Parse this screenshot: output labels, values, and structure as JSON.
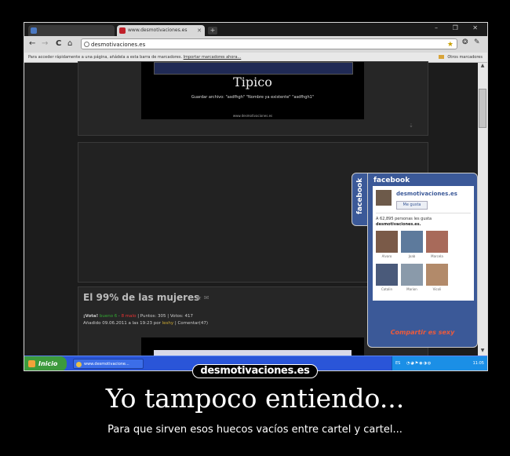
{
  "browser": {
    "tabs": [
      {
        "label": ""
      },
      {
        "label": "www.desmotivaciones.es"
      }
    ],
    "newtab_label": "+",
    "window_controls": "– ❐ ✕",
    "nav": {
      "back": "←",
      "forward": "→",
      "reload": "C",
      "home": "⌂"
    },
    "url": "desmotivaciones.es",
    "bookmarks_bar": {
      "message": "Para acceder rápidamente a una página, añádela a esta barra de marcadores.",
      "import_link": "Importar marcadores ahora...",
      "other_bookmarks": "Otros marcadores"
    }
  },
  "page": {
    "poster1": {
      "title": "Tipico",
      "subtitle": "Guardar archivo: \"asdfhgh\" \"Nombre ya existente\" \"asdfhgh1\"",
      "site": "www.desmotivaciones.es"
    },
    "post": {
      "title": "El 99% de las mujeres",
      "vote_label": "¡Vota!",
      "good": "bueno 6",
      "bad": "8 malo",
      "points": "| Puntos: 305 | Votos: 417",
      "added": "Añadido 09.06.2011 a las 19:23 por",
      "user": "leshy",
      "comments": "| Comentar(47)"
    }
  },
  "facebook_widget": {
    "tab_label": "facebook",
    "header": "facebook",
    "page_name": "desmotivaciones.es",
    "like_button": "Me gusta",
    "count_text": "A 62,895 personas les gusta",
    "count_page": "desmotivaciones.es.",
    "fans": [
      {
        "name": "Alvaro",
        "color": "#7a5a48"
      },
      {
        "name": "Joab",
        "color": "#5d7a9c"
      },
      {
        "name": "Marcela",
        "color": "#a86a5a"
      },
      {
        "name": "Catalin",
        "color": "#4a5a7a"
      },
      {
        "name": "Marion",
        "color": "#8a9aaa"
      },
      {
        "name": "Vicoli",
        "color": "#b28a6a"
      }
    ],
    "footer": "Compartir es sexy"
  },
  "taskbar": {
    "start": "Inicio",
    "task": "www.desmotivacione...",
    "lang": "ES",
    "clock": "11:05"
  },
  "brand": "desmotivaciones.es",
  "headline": "Yo tampoco entiendo...",
  "subline": "Para que sirven esos huecos vacíos entre cartel y cartel..."
}
